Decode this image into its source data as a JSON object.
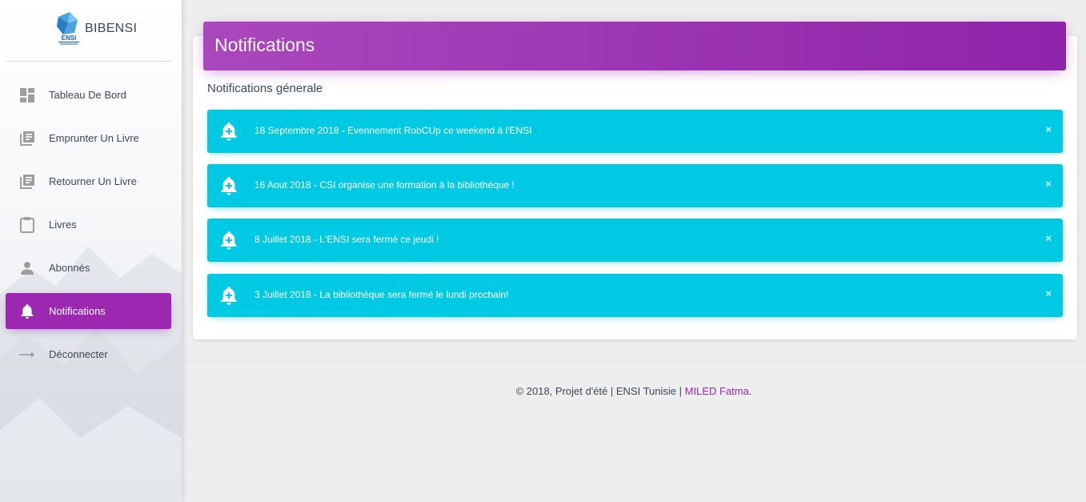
{
  "brand": {
    "name": "BIBENSI",
    "logo_text": "ENSI"
  },
  "sidebar": {
    "items": [
      {
        "label": "Tableau De Bord",
        "icon": "dashboard-icon"
      },
      {
        "label": "Emprunter Un Livre",
        "icon": "library-books-icon"
      },
      {
        "label": "Retourner Un Livre",
        "icon": "library-books-icon"
      },
      {
        "label": "Livres",
        "icon": "clipboard-icon"
      },
      {
        "label": "Abonnés",
        "icon": "person-icon"
      },
      {
        "label": "Notifications",
        "icon": "bell-icon",
        "active": true
      },
      {
        "label": "Déconnecter",
        "icon": "arrow-right-icon"
      }
    ]
  },
  "main": {
    "header_title": "Notifications",
    "section_title": "Notifications génerale",
    "alerts": [
      {
        "message": "18 Septembre 2018 - Evennement RobCUp ce weekend à l'ENSI",
        "close": "×"
      },
      {
        "message": "16 Aout 2018 - CSI organise une formation à la bibliothéque !",
        "close": "×"
      },
      {
        "message": "8 Juillet 2018 - L'ENSI sera fermé ce jeudi !",
        "close": "×"
      },
      {
        "message": "3 Juillet 2018 - La bibliothéque sera fermé le lundi prochain!",
        "close": "×"
      }
    ]
  },
  "footer": {
    "text": "© 2018, Projet d'été | ENSI Tunisie | ",
    "author": "MILED Fatma",
    "suffix": "."
  },
  "colors": {
    "accent": "#9c27b0",
    "alert": "#00cae3",
    "background": "#eeeeee"
  }
}
